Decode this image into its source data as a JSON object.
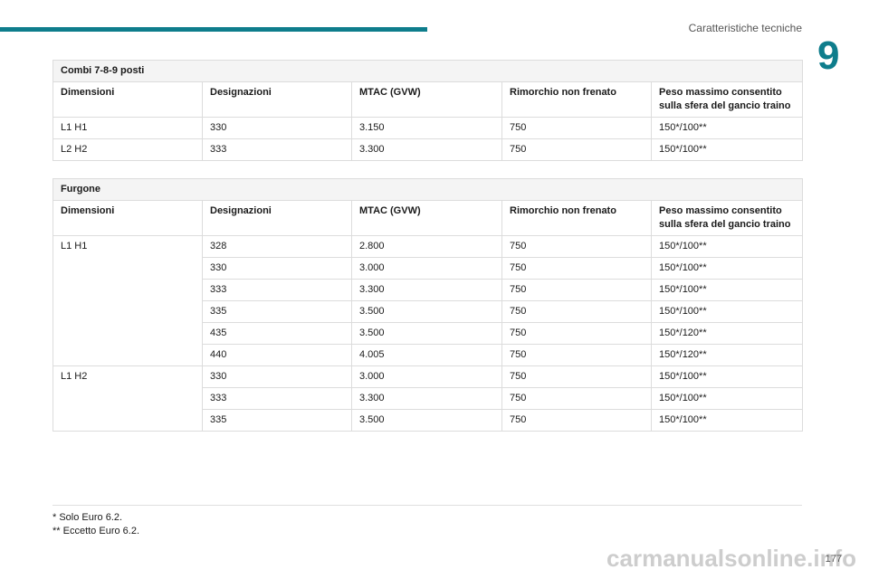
{
  "header": {
    "section_title": "Caratteristiche tecniche",
    "chapter_number": "9"
  },
  "combi": {
    "title": "Combi 7-8-9 posti",
    "headers": [
      "Dimensioni",
      "Designazioni",
      "MTAC (GVW)",
      "Rimorchio non frenato",
      "Peso massimo consentito sulla sfera del gancio traino"
    ],
    "rows": [
      [
        "L1 H1",
        "330",
        "3.150",
        "750",
        "150*/100**"
      ],
      [
        "L2 H2",
        "333",
        "3.300",
        "750",
        "150*/100**"
      ]
    ]
  },
  "furgone": {
    "title": "Furgone",
    "headers": [
      "Dimensioni",
      "Designazioni",
      "MTAC (GVW)",
      "Rimorchio non frenato",
      "Peso massimo consentito sulla sfera del gancio traino"
    ],
    "rows": [
      [
        "L1 H1",
        "328",
        "2.800",
        "750",
        "150*/100**"
      ],
      [
        "",
        "330",
        "3.000",
        "750",
        "150*/100**"
      ],
      [
        "",
        "333",
        "3.300",
        "750",
        "150*/100**"
      ],
      [
        "",
        "335",
        "3.500",
        "750",
        "150*/100**"
      ],
      [
        "",
        "435",
        "3.500",
        "750",
        "150*/120**"
      ],
      [
        "",
        "440",
        "4.005",
        "750",
        "150*/120**"
      ],
      [
        "L1 H2",
        "330",
        "3.000",
        "750",
        "150*/100**"
      ],
      [
        "",
        "333",
        "3.300",
        "750",
        "150*/100**"
      ],
      [
        "",
        "335",
        "3.500",
        "750",
        "150*/100**"
      ]
    ]
  },
  "footnotes": [
    "* Solo Euro 6.2.",
    "** Eccetto Euro 6.2."
  ],
  "page_number": "177",
  "watermark": "carmanualsonline.info"
}
